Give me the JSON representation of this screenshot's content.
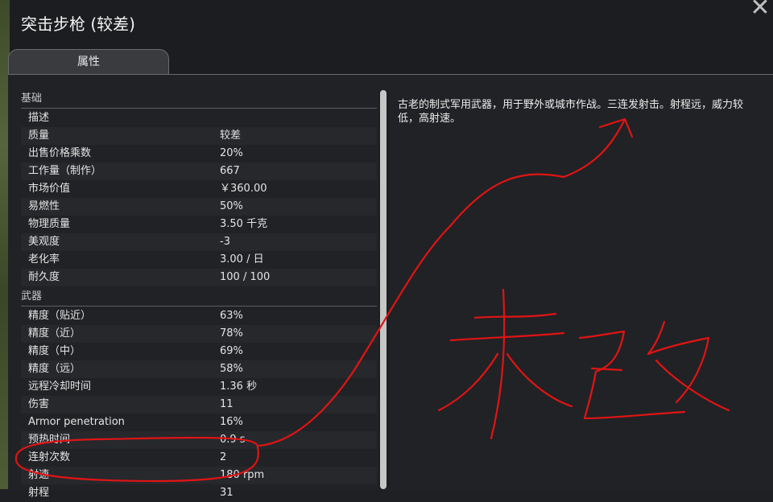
{
  "window": {
    "title": "突击步枪 (较差)",
    "close_glyph": "✕"
  },
  "tabs": [
    {
      "label": "属性"
    }
  ],
  "sections": [
    {
      "header": "基础",
      "rows": [
        {
          "label": "描述",
          "value": ""
        },
        {
          "label": "质量",
          "value": "较差"
        },
        {
          "label": "出售价格乘数",
          "value": "20%"
        },
        {
          "label": "工作量（制作）",
          "value": "667"
        },
        {
          "label": "市场价值",
          "value": "￥360.00"
        },
        {
          "label": "易燃性",
          "value": "50%"
        },
        {
          "label": "物理质量",
          "value": "3.50 千克"
        },
        {
          "label": "美观度",
          "value": "-3"
        },
        {
          "label": "老化率",
          "value": "3.00 / 日"
        },
        {
          "label": "耐久度",
          "value": "100 / 100"
        }
      ]
    },
    {
      "header": "武器",
      "rows": [
        {
          "label": "精度（贴近）",
          "value": "63%"
        },
        {
          "label": "精度（近）",
          "value": "78%"
        },
        {
          "label": "精度（中）",
          "value": "69%"
        },
        {
          "label": "精度（远）",
          "value": "58%"
        },
        {
          "label": "远程冷却时间",
          "value": "1.36 秒"
        },
        {
          "label": "伤害",
          "value": "11"
        },
        {
          "label": "Armor penetration",
          "value": "16%"
        },
        {
          "label": "预热时间",
          "value": "0.9 s"
        },
        {
          "label": "连射次数",
          "value": "2"
        },
        {
          "label": "射速",
          "value": "180 rpm"
        },
        {
          "label": "射程",
          "value": "31"
        }
      ]
    }
  ],
  "description": "古老的制式军用武器，用于野外或城市作战。三连发射击。射程远，威力较低，高射速。",
  "annotation": {
    "text": "未改",
    "color": "#e01414"
  },
  "colors": {
    "background": "#1c1d20",
    "panel": "#212225",
    "annotation_red": "#e01414"
  }
}
